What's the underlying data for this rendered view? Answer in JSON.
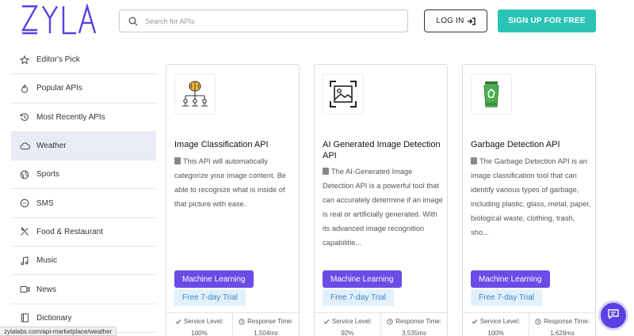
{
  "header": {
    "logo_text": "ZYLA",
    "search_placeholder": "Search for APIs",
    "login_label": "LOG IN",
    "signup_label": "SIGN UP FOR FREE"
  },
  "sidebar": {
    "items": [
      {
        "label": "Editor's Pick",
        "icon": "star-icon"
      },
      {
        "label": "Popular APIs",
        "icon": "flame-icon"
      },
      {
        "label": "Most Recently APIs",
        "icon": "history-icon"
      },
      {
        "label": "Weather",
        "icon": "cloud-icon",
        "active": true
      },
      {
        "label": "Sports",
        "icon": "ball-icon"
      },
      {
        "label": "SMS",
        "icon": "message-icon"
      },
      {
        "label": "Food & Restaurant",
        "icon": "utensils-icon"
      },
      {
        "label": "Music",
        "icon": "music-note-icon"
      },
      {
        "label": "News",
        "icon": "video-icon"
      },
      {
        "label": "Dictionary",
        "icon": "book-icon"
      }
    ]
  },
  "cards": [
    {
      "title": "Image Classification API",
      "description": "This API will automatically categorize your image content. Be able to recognize what is inside of that picture with ease.",
      "tag": "Machine Learning",
      "trial": "Free 7-day Trial",
      "service_level_label": "Service Level:",
      "service_level_value": "100%",
      "response_time_label": "Response Time:",
      "response_time_value": "1,504ms",
      "icon": "brain-network-icon"
    },
    {
      "title": "AI Generated Image Detection API",
      "description": "The AI-Generated Image Detection API is a powerful tool that can accurately determine if an image is real or artificially generated. With its advanced image recognition capabilitie...",
      "tag": "Machine Learning",
      "trial": "Free 7-day Trial",
      "service_level_label": "Service Level:",
      "service_level_value": "92%",
      "response_time_label": "Response Time:",
      "response_time_value": "3,535ms",
      "icon": "image-scan-icon"
    },
    {
      "title": "Garbage Detection API",
      "description": "The Garbage Detection API is an image classification tool that can identify various types of garbage, including plastic, glass, metal, paper, biological waste, clothing, trash, sho...",
      "tag": "Machine Learning",
      "trial": "Free 7-day Trial",
      "service_level_label": "Service Level:",
      "service_level_value": "100%",
      "response_time_label": "Response Time:",
      "response_time_value": "1,628ms",
      "icon": "recycle-bin-icon"
    }
  ],
  "status_url": "zylalabs.com/api-marketplace/weather",
  "colors": {
    "brand_purple": "#5b3fe0",
    "tag_purple": "#6b4ce6",
    "signup_teal": "#2bc3b3",
    "trial_bg": "#e1f0fb",
    "trial_text": "#3a86c8"
  }
}
